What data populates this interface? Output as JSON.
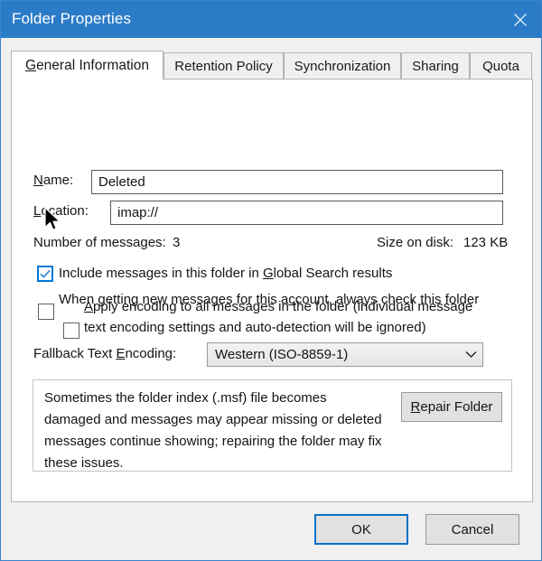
{
  "window": {
    "title": "Folder Properties",
    "close_icon": "close-icon",
    "titlebar_color": "#2b7cc7",
    "accent_color": "#0078d7"
  },
  "tabs": [
    {
      "label": "General Information",
      "accesskey": "G",
      "active": true
    },
    {
      "label": "Retention Policy",
      "accesskey": "",
      "active": false
    },
    {
      "label": "Synchronization",
      "accesskey": "",
      "active": false
    },
    {
      "label": "Sharing",
      "accesskey": "",
      "active": false
    },
    {
      "label": "Quota",
      "accesskey": "",
      "active": false
    }
  ],
  "general": {
    "name_label": "Name:",
    "name_value": "Deleted",
    "location_label": "Location:",
    "location_value": "imap://",
    "messages_label": "Number of messages:",
    "messages_value": "3",
    "size_label": "Size on disk:",
    "size_value": "123 KB",
    "global_search": {
      "text_before": "Include messages in this folder in ",
      "accesskey": "G",
      "text_after": "lobal Search results",
      "checked": true,
      "hover": true
    },
    "check_new": {
      "text_before": "When getting new messages for this a",
      "accesskey": "c",
      "text_after": "count, always check this folder",
      "checked": false
    },
    "encoding_label_before": "Fallback Text ",
    "encoding_label_key": "E",
    "encoding_label_after": "ncoding:",
    "encoding_value": "Western (ISO-8859-1)",
    "encoding_arrow_icon": "chevron-down-icon",
    "apply_encoding": {
      "accesskey": "A",
      "text_after": "pply encoding to all messages in the folder (individual message text encoding settings and auto-detection will be ignored)",
      "checked": false
    }
  },
  "repair": {
    "description": "Sometimes the folder index (.msf) file becomes damaged and messages may appear missing or deleted messages continue showing; repairing the folder may fix these issues.",
    "button_accesskey": "R",
    "button_label_after": "epair Folder"
  },
  "footer": {
    "ok_label": "OK",
    "cancel_label": "Cancel"
  },
  "cursor": {
    "icon": "mouse-pointer-arrow"
  }
}
